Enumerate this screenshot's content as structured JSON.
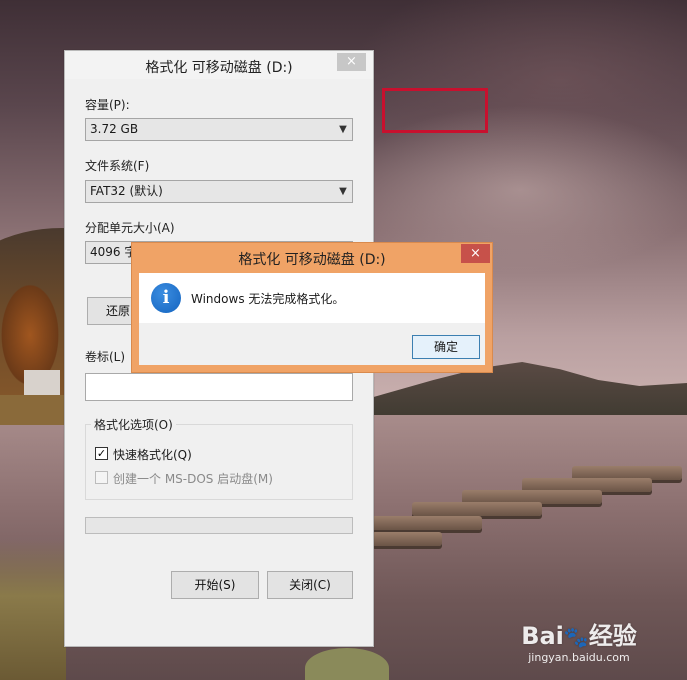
{
  "format_dialog": {
    "title": "格式化 可移动磁盘 (D:)",
    "close_glyph": "×",
    "capacity_label": "容量(P):",
    "capacity_value": "3.72 GB",
    "filesystem_label": "文件系统(F)",
    "filesystem_value": "FAT32 (默认)",
    "allocation_label": "分配单元大小(A)",
    "allocation_value_visible": "4096 字",
    "restore_button_visible": "还原",
    "volume_label": "卷标(L)",
    "volume_value": "",
    "options_group_label": "格式化选项(O)",
    "quick_format_label": "快速格式化(Q)",
    "quick_format_checked": true,
    "msdos_label": "创建一个 MS-DOS 启动盘(M)",
    "msdos_checked": false,
    "progress_fraction": 0,
    "start_button": "开始(S)",
    "close_button": "关闭(C)"
  },
  "error_dialog": {
    "title": "格式化 可移动磁盘 (D:)",
    "close_glyph": "×",
    "icon": "info-icon",
    "icon_glyph": "i",
    "message": "Windows 无法完成格式化。",
    "ok_button": "确定"
  },
  "watermark": {
    "logo": "Bai",
    "logo_suffix": "经验",
    "paw_glyph": "🐾",
    "url": "jingyan.baidu.com"
  },
  "colors": {
    "error_dialog_frame": "#f0a366",
    "close_button_active": "#c7514a",
    "highlight_box": "#c8102e",
    "info_icon": "#1464c0"
  }
}
